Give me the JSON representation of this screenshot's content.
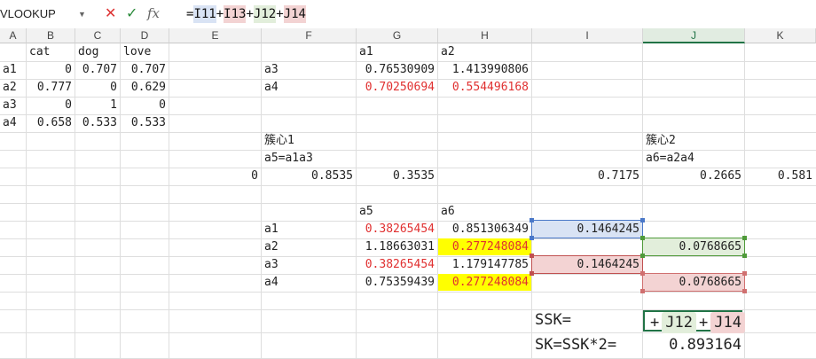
{
  "formula_bar": {
    "name_box": "VLOOKUP",
    "cancel": "✕",
    "enter": "✓",
    "fx": "fx",
    "formula_parts": [
      "=",
      "I11",
      "+",
      "I13",
      "+",
      "J12",
      "+",
      "J14"
    ]
  },
  "columns": [
    "A",
    "B",
    "C",
    "D",
    "E",
    "F",
    "G",
    "H",
    "I",
    "J",
    "K"
  ],
  "selected_column": "J",
  "cells": [
    {
      "ref": "B2",
      "v": "cat",
      "align": "l"
    },
    {
      "ref": "C2",
      "v": "dog",
      "align": "l"
    },
    {
      "ref": "D2",
      "v": "love",
      "align": "l"
    },
    {
      "ref": "G2",
      "v": "a1",
      "align": "l"
    },
    {
      "ref": "H2",
      "v": "a2",
      "align": "l"
    },
    {
      "ref": "A3",
      "v": "a1",
      "align": "l"
    },
    {
      "ref": "B3",
      "v": "0",
      "align": "r"
    },
    {
      "ref": "C3",
      "v": "0.707",
      "align": "r"
    },
    {
      "ref": "D3",
      "v": "0.707",
      "align": "r"
    },
    {
      "ref": "F3",
      "v": "a3",
      "align": "l"
    },
    {
      "ref": "G3",
      "v": "0.76530909",
      "align": "r"
    },
    {
      "ref": "H3",
      "v": "1.413990806",
      "align": "r"
    },
    {
      "ref": "A4",
      "v": "a2",
      "align": "l"
    },
    {
      "ref": "B4",
      "v": "0.777",
      "align": "r"
    },
    {
      "ref": "C4",
      "v": "0",
      "align": "r"
    },
    {
      "ref": "D4",
      "v": "0.629",
      "align": "r"
    },
    {
      "ref": "F4",
      "v": "a4",
      "align": "l"
    },
    {
      "ref": "G4",
      "v": "0.70250694",
      "align": "r",
      "color": "red"
    },
    {
      "ref": "H4",
      "v": "0.554496168",
      "align": "r",
      "color": "red"
    },
    {
      "ref": "A5",
      "v": "a3",
      "align": "l"
    },
    {
      "ref": "B5",
      "v": "0",
      "align": "r"
    },
    {
      "ref": "C5",
      "v": "1",
      "align": "r"
    },
    {
      "ref": "D5",
      "v": "0",
      "align": "r"
    },
    {
      "ref": "A6",
      "v": "a4",
      "align": "l"
    },
    {
      "ref": "B6",
      "v": "0.658",
      "align": "r"
    },
    {
      "ref": "C6",
      "v": "0.533",
      "align": "r"
    },
    {
      "ref": "D6",
      "v": "0.533",
      "align": "r"
    },
    {
      "ref": "F7",
      "v": "簇心1",
      "align": "l"
    },
    {
      "ref": "J7",
      "v": "簇心2",
      "align": "l"
    },
    {
      "ref": "F8",
      "v": "a5=a1a3",
      "align": "l"
    },
    {
      "ref": "J8",
      "v": "a6=a2a4",
      "align": "l"
    },
    {
      "ref": "E9",
      "v": "0",
      "align": "r"
    },
    {
      "ref": "F9",
      "v": "0.8535",
      "align": "r"
    },
    {
      "ref": "G9",
      "v": "0.3535",
      "align": "r"
    },
    {
      "ref": "I9",
      "v": "0.7175",
      "align": "r"
    },
    {
      "ref": "J9",
      "v": "0.2665",
      "align": "r"
    },
    {
      "ref": "K9",
      "v": "0.581",
      "align": "r"
    },
    {
      "ref": "G10",
      "v": "a5",
      "align": "l"
    },
    {
      "ref": "H10",
      "v": "a6",
      "align": "l"
    },
    {
      "ref": "F11",
      "v": "a1",
      "align": "l"
    },
    {
      "ref": "G11",
      "v": "0.38265454",
      "align": "r",
      "color": "red"
    },
    {
      "ref": "H11",
      "v": "0.851306349",
      "align": "r"
    },
    {
      "ref": "I11",
      "v": "0.1464245",
      "align": "r",
      "bg": "blue"
    },
    {
      "ref": "F12",
      "v": "a2",
      "align": "l"
    },
    {
      "ref": "G12",
      "v": "1.18663031",
      "align": "r"
    },
    {
      "ref": "H12",
      "v": "0.277248084",
      "align": "r",
      "color": "red",
      "bg": "yellow"
    },
    {
      "ref": "J12",
      "v": "0.0768665",
      "align": "r",
      "bg": "green"
    },
    {
      "ref": "F13",
      "v": "a3",
      "align": "l"
    },
    {
      "ref": "G13",
      "v": "0.38265454",
      "align": "r",
      "color": "red"
    },
    {
      "ref": "H13",
      "v": "1.179147785",
      "align": "r"
    },
    {
      "ref": "I13",
      "v": "0.1464245",
      "align": "r",
      "bg": "red"
    },
    {
      "ref": "F14",
      "v": "a4",
      "align": "l"
    },
    {
      "ref": "G14",
      "v": "0.75359439",
      "align": "r"
    },
    {
      "ref": "H14",
      "v": "0.277248084",
      "align": "r",
      "color": "red",
      "bg": "yellow"
    },
    {
      "ref": "J14",
      "v": "0.0768665",
      "align": "r",
      "bg": "red"
    },
    {
      "ref": "I16",
      "v": "SSK=",
      "align": "l",
      "big": true
    },
    {
      "ref": "I17",
      "v": "SK=SSK*2=",
      "align": "l",
      "big": true
    },
    {
      "ref": "J17",
      "v": "0.893164",
      "align": "r",
      "big": true
    }
  ],
  "editing_cell": {
    "ref": "J16",
    "parts": [
      "+",
      "J12",
      "+",
      "J14"
    ]
  },
  "colors": {
    "red_text": "#e03030",
    "blue_fill": "#d9e3f4",
    "green_fill": "#e2eedb",
    "red_fill": "#f3d3d3",
    "yellow_fill": "#ffff00",
    "excel_green": "#217346"
  }
}
